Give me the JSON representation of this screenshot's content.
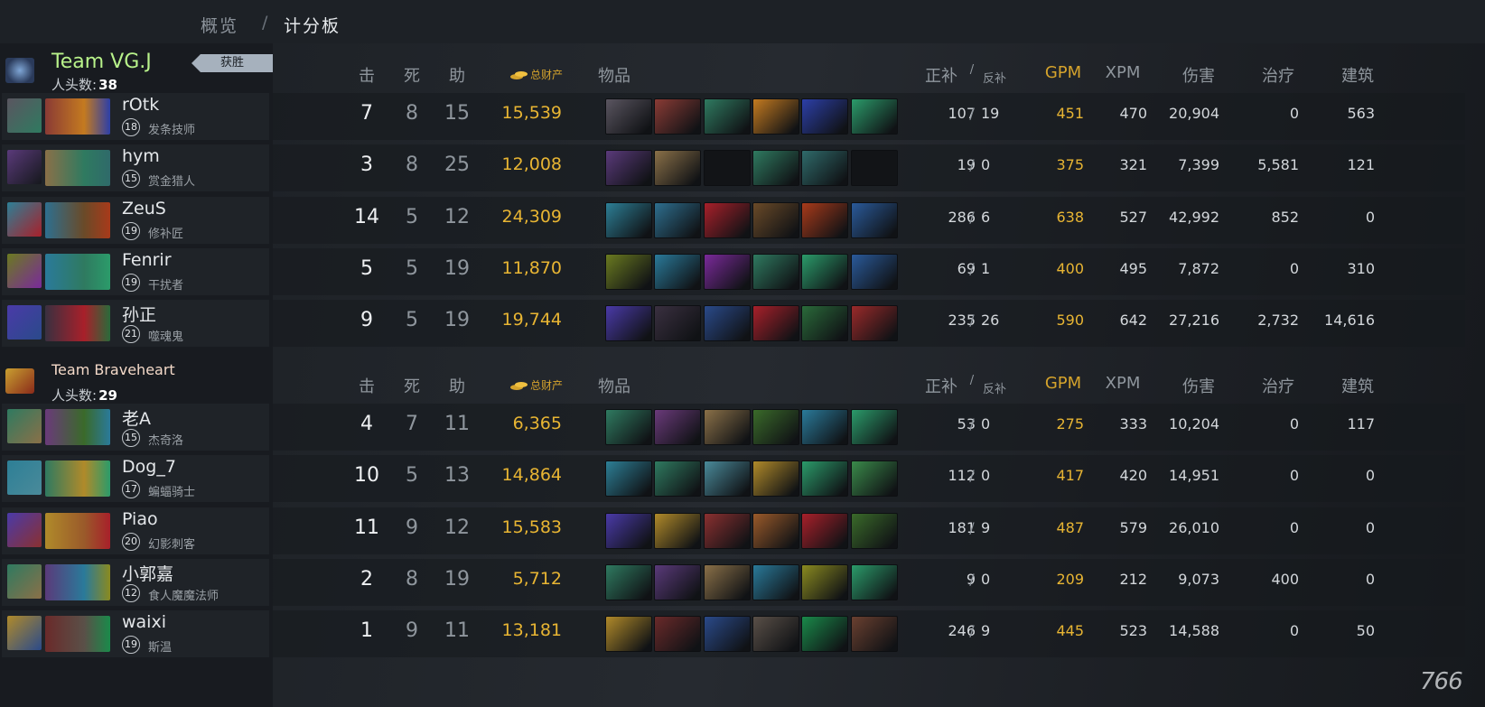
{
  "breadcrumb": {
    "overview": "概览",
    "separator": "/",
    "current": "计分板"
  },
  "headers": {
    "kills": "击",
    "deaths": "死",
    "assists": "助",
    "networth": "总财产",
    "items": "物品",
    "last_hits": "正补",
    "slash": "/",
    "denies": "反补",
    "gpm": "GPM",
    "xpm": "XPM",
    "damage": "伤害",
    "healing": "治疗",
    "building": "建筑"
  },
  "colors": {
    "gold": "#e8b533",
    "team1_name": "#b8f28a",
    "team2_name": "#f3d9c8"
  },
  "teams": [
    {
      "name": "Team VG.J",
      "kills_label": "人头数:",
      "kills": "38",
      "badge": "获胜",
      "players": [
        {
          "name": "rOtk",
          "level": "18",
          "hero": "发条技师",
          "k": "7",
          "d": "8",
          "a": "15",
          "networth": "15,539",
          "lh": "107",
          "dn": "19",
          "gpm": "451",
          "xpm": "470",
          "dmg": "20,904",
          "heal": "0",
          "bld": "563",
          "items": [
            "#5a5560",
            "#8a3b35",
            "#2f7a60",
            "#c47a20",
            "#2c3fa8",
            "#2b9b6a"
          ]
        },
        {
          "name": "hym",
          "level": "15",
          "hero": "赏金猎人",
          "k": "3",
          "d": "8",
          "a": "25",
          "networth": "12,008",
          "lh": "19",
          "dn": "0",
          "gpm": "375",
          "xpm": "321",
          "dmg": "7,399",
          "heal": "5,581",
          "bld": "121",
          "items": [
            "#5a3a7a",
            "#8a7048",
            "#15181c",
            "#2f7a60",
            "#2f6a6a",
            "#15181c"
          ]
        },
        {
          "name": "ZeuS",
          "level": "19",
          "hero": "修补匠",
          "k": "14",
          "d": "5",
          "a": "12",
          "networth": "24,309",
          "lh": "286",
          "dn": "6",
          "gpm": "638",
          "xpm": "527",
          "dmg": "42,992",
          "heal": "852",
          "bld": "0",
          "items": [
            "#2d7f96",
            "#2e6f8f",
            "#a8202a",
            "#6a4a28",
            "#a83a1a",
            "#2a5a9a"
          ]
        },
        {
          "name": "Fenrir",
          "level": "19",
          "hero": "干扰者",
          "k": "5",
          "d": "5",
          "a": "19",
          "networth": "11,870",
          "lh": "69",
          "dn": "1",
          "gpm": "400",
          "xpm": "495",
          "dmg": "7,872",
          "heal": "0",
          "bld": "310",
          "items": [
            "#6a7a20",
            "#2a7a9a",
            "#7a2a9a",
            "#2f7a60",
            "#2b9b6a",
            "#2a5a9a"
          ]
        },
        {
          "name": "孙正",
          "level": "21",
          "hero": "噬魂鬼",
          "k": "9",
          "d": "5",
          "a": "19",
          "networth": "19,744",
          "lh": "235",
          "dn": "26",
          "gpm": "590",
          "xpm": "642",
          "dmg": "27,216",
          "heal": "2,732",
          "bld": "14,616",
          "items": [
            "#4a3aa8",
            "#3a3040",
            "#2a4a8a",
            "#a8202a",
            "#2a6a3a",
            "#9a2a2a"
          ]
        }
      ]
    },
    {
      "name": "Team Braveheart",
      "kills_label": "人头数:",
      "kills": "29",
      "players": [
        {
          "name": "老A",
          "level": "15",
          "hero": "杰奇洛",
          "k": "4",
          "d": "7",
          "a": "11",
          "networth": "6,365",
          "lh": "53",
          "dn": "0",
          "gpm": "275",
          "xpm": "333",
          "dmg": "10,204",
          "heal": "0",
          "bld": "117",
          "items": [
            "#2f7a60",
            "#6a3a7a",
            "#8a7048",
            "#3a6a2a",
            "#2a7a9a",
            "#2b9b6a"
          ]
        },
        {
          "name": "Dog_7",
          "level": "17",
          "hero": "蝙蝠骑士",
          "k": "10",
          "d": "5",
          "a": "13",
          "networth": "14,864",
          "lh": "112",
          "dn": "0",
          "gpm": "417",
          "xpm": "420",
          "dmg": "14,951",
          "heal": "0",
          "bld": "0",
          "items": [
            "#2d7f96",
            "#2f7a60",
            "#4a8a9a",
            "#b08a2a",
            "#2b9b6a",
            "#3a8a4a"
          ]
        },
        {
          "name": "Piao",
          "level": "20",
          "hero": "幻影刺客",
          "k": "11",
          "d": "9",
          "a": "12",
          "networth": "15,583",
          "lh": "181",
          "dn": "9",
          "gpm": "487",
          "xpm": "579",
          "dmg": "26,010",
          "heal": "0",
          "bld": "0",
          "items": [
            "#4a3aa8",
            "#b08a2a",
            "#8a3030",
            "#9a5a2a",
            "#a8202a",
            "#3a6a2a"
          ]
        },
        {
          "name": "小郭嘉",
          "level": "12",
          "hero": "食人魔魔法师",
          "k": "2",
          "d": "8",
          "a": "19",
          "networth": "5,712",
          "lh": "9",
          "dn": "0",
          "gpm": "209",
          "xpm": "212",
          "dmg": "9,073",
          "heal": "400",
          "bld": "0",
          "items": [
            "#2f7a60",
            "#5a3a7a",
            "#8a7048",
            "#2a7a9a",
            "#8a8a20",
            "#2b9b6a"
          ]
        },
        {
          "name": "waixi",
          "level": "19",
          "hero": "斯温",
          "k": "1",
          "d": "9",
          "a": "11",
          "networth": "13,181",
          "lh": "246",
          "dn": "9",
          "gpm": "445",
          "xpm": "523",
          "dmg": "14,588",
          "heal": "0",
          "bld": "50",
          "items": [
            "#b08a2a",
            "#6a2a2a",
            "#2a4a8a",
            "#5a5048",
            "#1a8a4a",
            "#6a4030"
          ]
        }
      ]
    }
  ],
  "watermark": "766"
}
